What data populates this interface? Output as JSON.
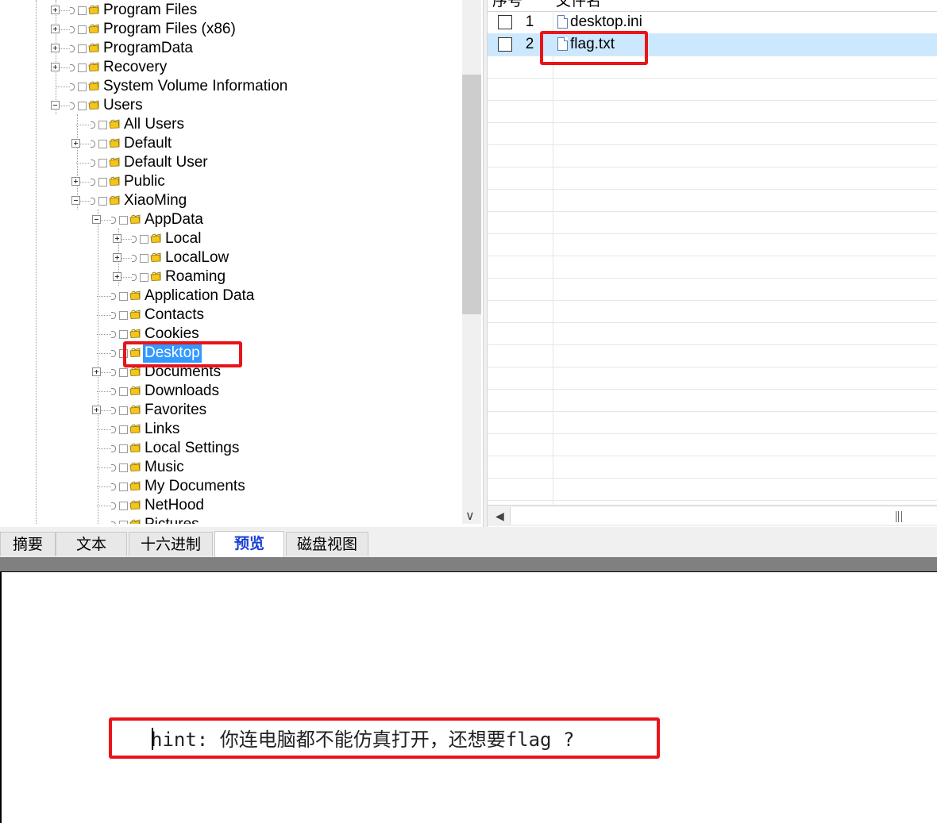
{
  "tree": {
    "items": [
      {
        "label": "Program Files",
        "level": 0,
        "expander": "plus"
      },
      {
        "label": "Program Files (x86)",
        "level": 0,
        "expander": "plus"
      },
      {
        "label": "ProgramData",
        "level": 0,
        "expander": "plus"
      },
      {
        "label": "Recovery",
        "level": 0,
        "expander": "plus"
      },
      {
        "label": "System Volume Information",
        "level": 0,
        "expander": "none"
      },
      {
        "label": "Users",
        "level": 0,
        "expander": "minus"
      },
      {
        "label": "All Users",
        "level": 1,
        "expander": "none"
      },
      {
        "label": "Default",
        "level": 1,
        "expander": "plus"
      },
      {
        "label": "Default User",
        "level": 1,
        "expander": "none"
      },
      {
        "label": "Public",
        "level": 1,
        "expander": "plus"
      },
      {
        "label": "XiaoMing",
        "level": 1,
        "expander": "minus"
      },
      {
        "label": "AppData",
        "level": 2,
        "expander": "minus"
      },
      {
        "label": "Local",
        "level": 3,
        "expander": "plus"
      },
      {
        "label": "LocalLow",
        "level": 3,
        "expander": "plus"
      },
      {
        "label": "Roaming",
        "level": 3,
        "expander": "plus"
      },
      {
        "label": "Application Data",
        "level": 2,
        "expander": "none"
      },
      {
        "label": "Contacts",
        "level": 2,
        "expander": "none"
      },
      {
        "label": "Cookies",
        "level": 2,
        "expander": "none"
      },
      {
        "label": "Desktop",
        "level": 2,
        "expander": "none",
        "selected": true
      },
      {
        "label": "Documents",
        "level": 2,
        "expander": "plus"
      },
      {
        "label": "Downloads",
        "level": 2,
        "expander": "none"
      },
      {
        "label": "Favorites",
        "level": 2,
        "expander": "plus"
      },
      {
        "label": "Links",
        "level": 2,
        "expander": "none"
      },
      {
        "label": "Local Settings",
        "level": 2,
        "expander": "none"
      },
      {
        "label": "Music",
        "level": 2,
        "expander": "none"
      },
      {
        "label": "My Documents",
        "level": 2,
        "expander": "none"
      },
      {
        "label": "NetHood",
        "level": 2,
        "expander": "none"
      },
      {
        "label": "Pictures",
        "level": 2,
        "expander": "none"
      }
    ]
  },
  "file_list": {
    "headers": {
      "index": "序号",
      "name": "文件名"
    },
    "rows": [
      {
        "index": "1",
        "name": "desktop.ini",
        "selected": false
      },
      {
        "index": "2",
        "name": "flag.txt",
        "selected": true
      }
    ]
  },
  "tabs": [
    {
      "label": "摘要",
      "active": false
    },
    {
      "label": "文本",
      "active": false
    },
    {
      "label": "十六进制",
      "active": false
    },
    {
      "label": "预览",
      "active": true
    },
    {
      "label": "磁盘视图",
      "active": false
    }
  ],
  "preview": {
    "text": "hint: 你连电脑都不能仿真打开，还想要flag ?"
  },
  "colors": {
    "selection": "#3399ff",
    "row_selection": "#cce8ff",
    "active_tab": "#1a3fd6",
    "highlight_box": "#e8141a",
    "folder": "#f5c518"
  }
}
